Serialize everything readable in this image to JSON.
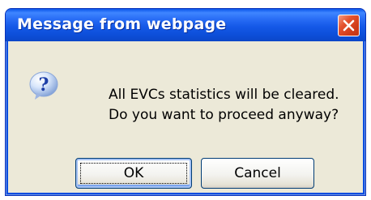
{
  "dialog": {
    "title": "Message from webpage",
    "message_line1": "All EVCs statistics will be cleared.",
    "message_line2": "Do you want to proceed anyway?",
    "icon": "question-icon",
    "close_icon": "close-icon",
    "buttons": {
      "ok_label": "OK",
      "cancel_label": "Cancel"
    }
  },
  "colors": {
    "titlebar": "#0a4de0",
    "close_button": "#d03c19",
    "dialog_background": "#ece9d8",
    "button_border": "#003c74"
  }
}
